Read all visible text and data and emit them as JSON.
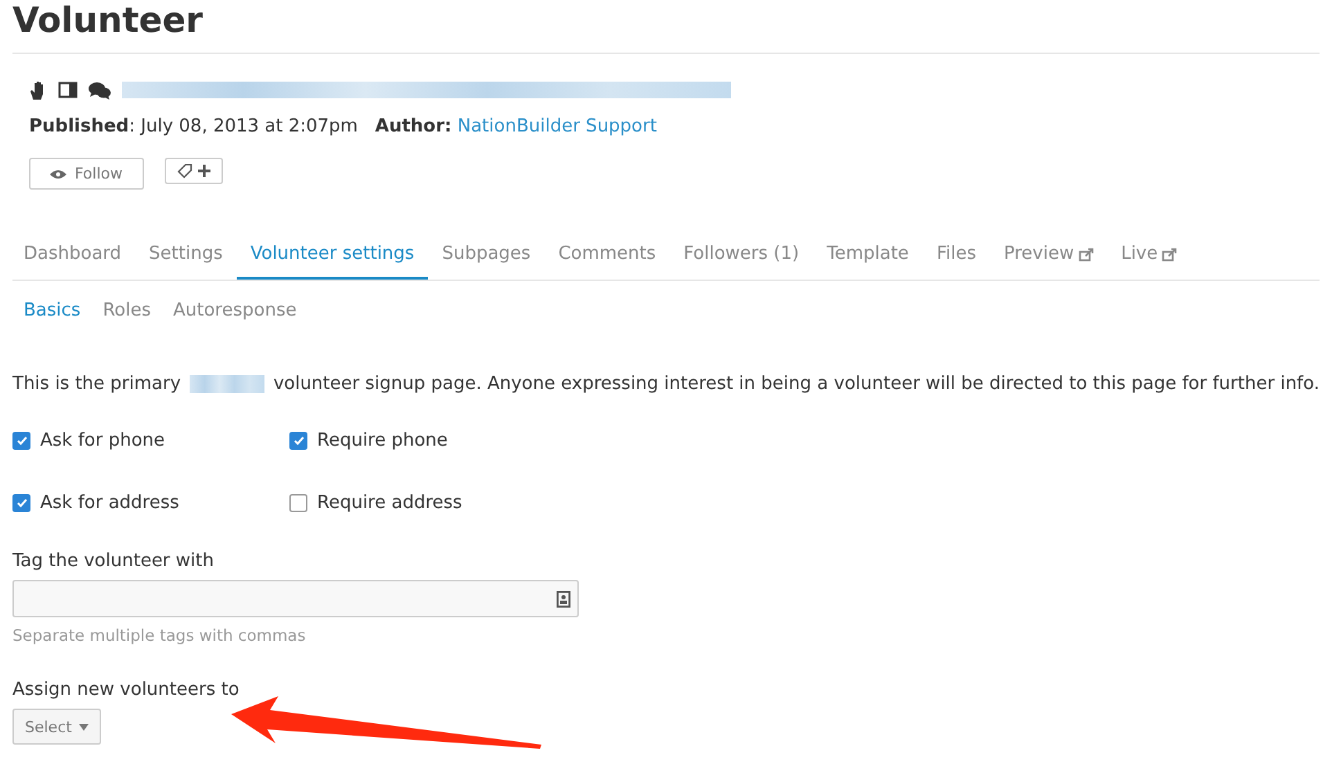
{
  "page": {
    "title": "Volunteer"
  },
  "meta": {
    "published_label": "Published",
    "published_value": ": July 08, 2013 at 2:07pm",
    "author_label": "Author:",
    "author": "NationBuilder Support"
  },
  "actions": {
    "follow": "Follow"
  },
  "tabs": [
    {
      "label": "Dashboard",
      "selected": false,
      "external": false
    },
    {
      "label": "Settings",
      "selected": false,
      "external": false
    },
    {
      "label": "Volunteer settings",
      "selected": true,
      "external": false
    },
    {
      "label": "Subpages",
      "selected": false,
      "external": false
    },
    {
      "label": "Comments",
      "selected": false,
      "external": false
    },
    {
      "label": "Followers (1)",
      "selected": false,
      "external": false
    },
    {
      "label": "Template",
      "selected": false,
      "external": false
    },
    {
      "label": "Files",
      "selected": false,
      "external": false
    },
    {
      "label": "Preview",
      "selected": false,
      "external": true
    },
    {
      "label": "Live",
      "selected": false,
      "external": true
    }
  ],
  "subtabs": [
    {
      "label": "Basics",
      "selected": true
    },
    {
      "label": "Roles",
      "selected": false
    },
    {
      "label": "Autoresponse",
      "selected": false
    }
  ],
  "intro": {
    "before": "This is the primary",
    "after": "volunteer signup page. Anyone expressing interest in being a volunteer will be directed to this page for further info."
  },
  "checkboxes": [
    {
      "label": "Ask for phone",
      "checked": true
    },
    {
      "label": "Require phone",
      "checked": true
    },
    {
      "label": "Ask for address",
      "checked": true
    },
    {
      "label": "Require address",
      "checked": false
    }
  ],
  "tag_field": {
    "label": "Tag the volunteer with",
    "help": "Separate multiple tags with commas"
  },
  "assign": {
    "label": "Assign new volunteers to",
    "value": "Select"
  }
}
